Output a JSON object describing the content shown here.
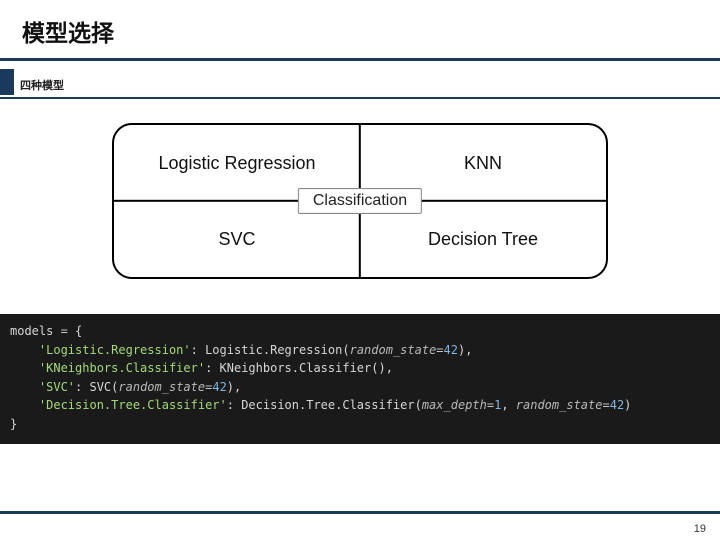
{
  "slide": {
    "title": "模型选择",
    "subtitle": "四种模型",
    "page_number": "19"
  },
  "diagram": {
    "cells": {
      "tl": "Logistic Regression",
      "tr": "KNN",
      "bl": "SVC",
      "br": "Decision Tree"
    },
    "center": "Classification"
  },
  "code": {
    "var": "models",
    "eq": " = ",
    "open": "{",
    "lines": [
      {
        "key": "'Logistic.Regression'",
        "call": "Logistic.Regression",
        "args": [
          {
            "k": "random_state",
            "v": "42"
          }
        ]
      },
      {
        "key": "'KNeighbors.Classifier'",
        "call": "KNeighbors.Classifier",
        "args": []
      },
      {
        "key": "'SVC'",
        "call": "SVC",
        "args": [
          {
            "k": "random_state",
            "v": "42"
          }
        ]
      },
      {
        "key": "'Decision.Tree.Classifier'",
        "call": "Decision.Tree.Classifier",
        "args": [
          {
            "k": "max_depth",
            "v": "1"
          },
          {
            "k": "random_state",
            "v": "42"
          }
        ]
      }
    ],
    "close": "}"
  }
}
